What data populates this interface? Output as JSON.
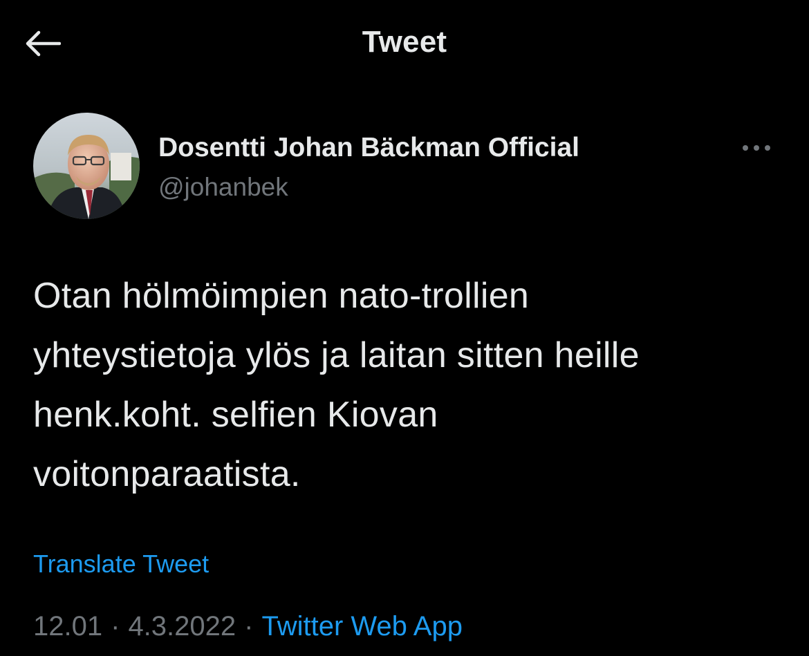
{
  "header": {
    "title": "Tweet",
    "back_icon": "arrow-left-icon"
  },
  "author": {
    "display_name": "Dosentti Johan Bäckman Official",
    "handle": "@johanbek",
    "avatar_icon": "profile-photo"
  },
  "more_icon": "more-horizontal-icon",
  "tweet": {
    "lines": [
      "Otan hölmöimpien nato-trollien",
      "yhteystietoja ylös ja laitan sitten heille",
      "henk.koht. selfien Kiovan",
      "voitonparaatista."
    ]
  },
  "translate_label": "Translate Tweet",
  "meta": {
    "time": "12.01",
    "separator": "·",
    "date": "4.3.2022",
    "source": "Twitter Web App"
  },
  "colors": {
    "background": "#000000",
    "text_primary": "#e7e9ea",
    "text_secondary": "#71767b",
    "accent": "#1d9bf0"
  }
}
